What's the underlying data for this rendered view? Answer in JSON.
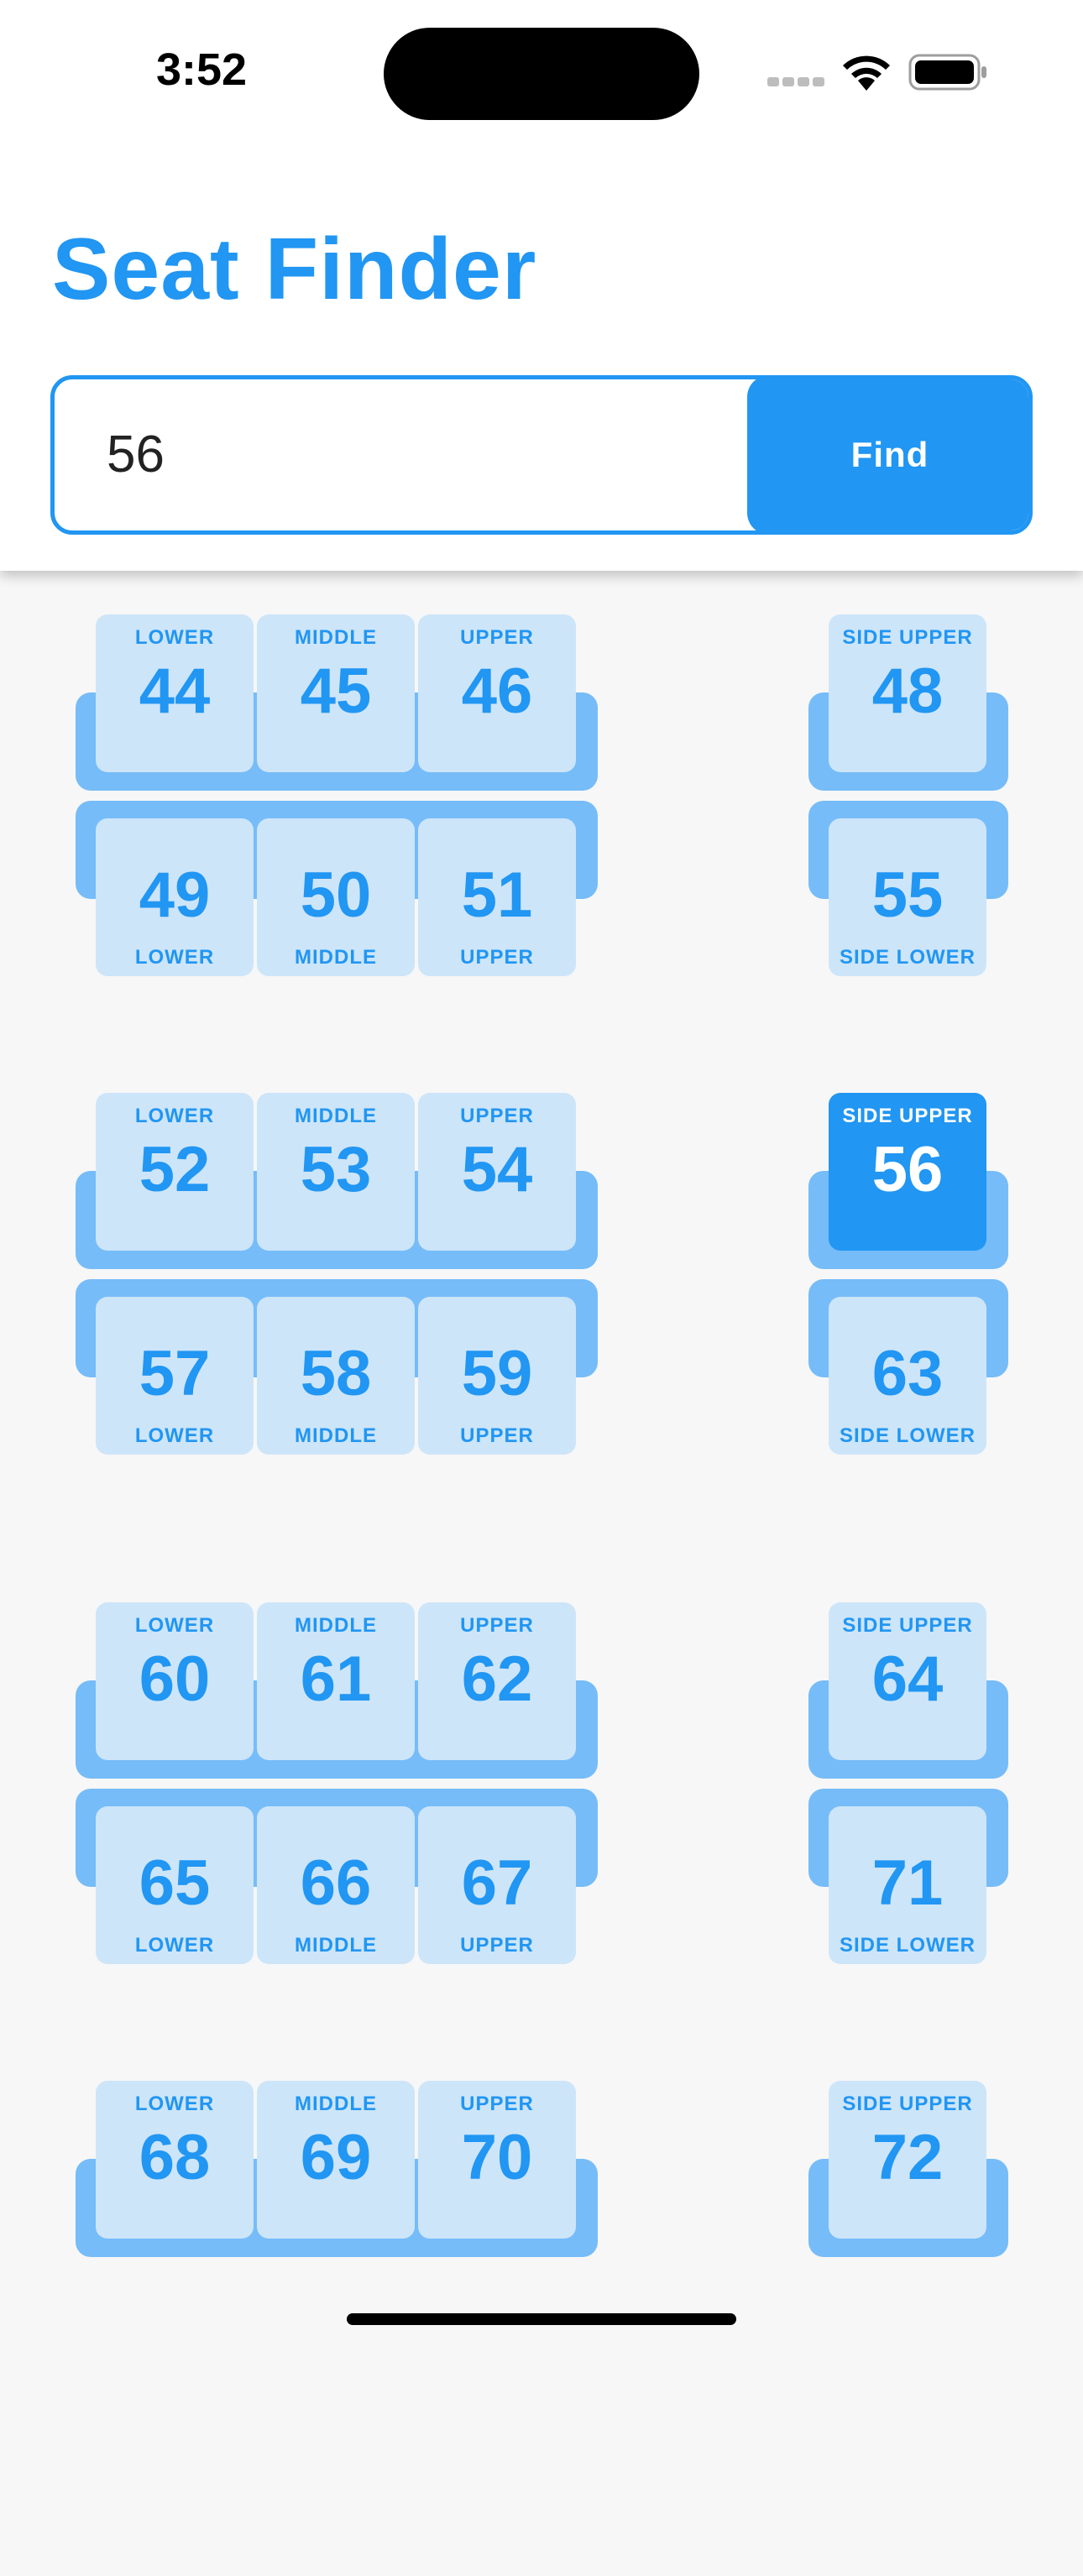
{
  "status_bar": {
    "time": "3:52"
  },
  "app": {
    "title": "Seat Finder"
  },
  "search": {
    "value": "56",
    "button_label": "Find"
  },
  "colors": {
    "accent": "#2196f3",
    "seat_bg": "#cde5f9",
    "berth_bar": "#76bcf8",
    "selected_seat": "#2196f3"
  },
  "selected_seat": "56",
  "bays": [
    {
      "main_top": [
        {
          "label": "LOWER",
          "number": "44"
        },
        {
          "label": "MIDDLE",
          "number": "45"
        },
        {
          "label": "UPPER",
          "number": "46"
        }
      ],
      "main_bottom": [
        {
          "label": "LOWER",
          "number": "49"
        },
        {
          "label": "MIDDLE",
          "number": "50"
        },
        {
          "label": "UPPER",
          "number": "51"
        }
      ],
      "side_top": {
        "label": "SIDE UPPER",
        "number": "48"
      },
      "side_bottom": {
        "label": "SIDE LOWER",
        "number": "55"
      }
    },
    {
      "main_top": [
        {
          "label": "LOWER",
          "number": "52"
        },
        {
          "label": "MIDDLE",
          "number": "53"
        },
        {
          "label": "UPPER",
          "number": "54"
        }
      ],
      "main_bottom": [
        {
          "label": "LOWER",
          "number": "57"
        },
        {
          "label": "MIDDLE",
          "number": "58"
        },
        {
          "label": "UPPER",
          "number": "59"
        }
      ],
      "side_top": {
        "label": "SIDE UPPER",
        "number": "56"
      },
      "side_bottom": {
        "label": "SIDE LOWER",
        "number": "63"
      }
    },
    {
      "main_top": [
        {
          "label": "LOWER",
          "number": "60"
        },
        {
          "label": "MIDDLE",
          "number": "61"
        },
        {
          "label": "UPPER",
          "number": "62"
        }
      ],
      "main_bottom": [
        {
          "label": "LOWER",
          "number": "65"
        },
        {
          "label": "MIDDLE",
          "number": "66"
        },
        {
          "label": "UPPER",
          "number": "67"
        }
      ],
      "side_top": {
        "label": "SIDE UPPER",
        "number": "64"
      },
      "side_bottom": {
        "label": "SIDE LOWER",
        "number": "71"
      }
    },
    {
      "main_top": [
        {
          "label": "LOWER",
          "number": "68"
        },
        {
          "label": "MIDDLE",
          "number": "69"
        },
        {
          "label": "UPPER",
          "number": "70"
        }
      ],
      "side_top": {
        "label": "SIDE UPPER",
        "number": "72"
      }
    }
  ]
}
